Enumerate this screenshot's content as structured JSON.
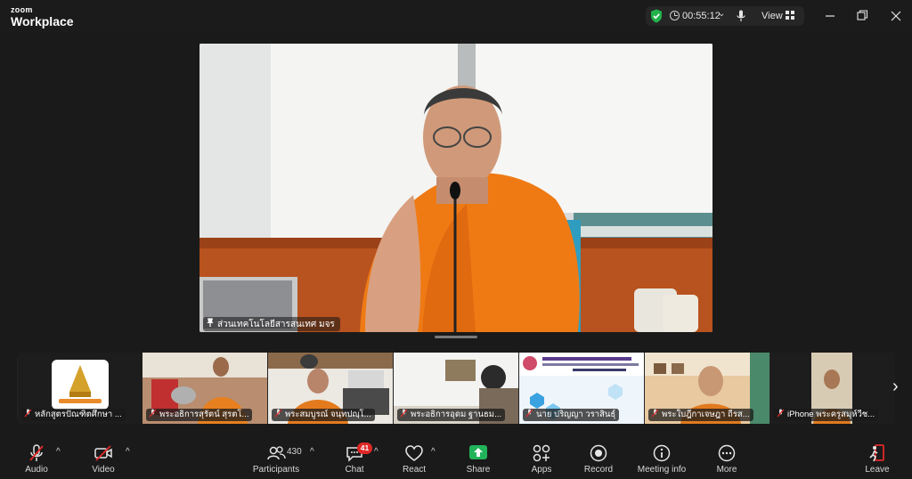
{
  "app": {
    "brand_top": "zoom",
    "brand_bottom": "Workplace"
  },
  "titlebar": {
    "timer": "00:55:12",
    "view_label": "View"
  },
  "main_video": {
    "name": "ส่วนเทคโนโลยีสารสนเทศ มจร"
  },
  "participants_strip": [
    {
      "name": "หลักสูตรปัณฑิตศึกษา ...",
      "muted": true
    },
    {
      "name": "พระอธิการสุรัตน์ สุรตโ...",
      "muted": true
    },
    {
      "name": "พระสมบูรณ์ จนฺทปญฺโ...",
      "muted": true
    },
    {
      "name": "พระอธิการอุดม ฐานธม...",
      "muted": true
    },
    {
      "name": "นาย ปริญญา วราสินธุ์",
      "muted": true
    },
    {
      "name": "พระใบฎีกาเจษฎา ถีรส...",
      "muted": true
    },
    {
      "name": "iPhone พระครูสมุห์วีช...",
      "muted": true
    }
  ],
  "toolbar": {
    "audio": "Audio",
    "video": "Video",
    "participants": "Participants",
    "participants_count": "430",
    "chat": "Chat",
    "chat_badge": "41",
    "react": "React",
    "share": "Share",
    "apps": "Apps",
    "record": "Record",
    "meeting_info": "Meeting info",
    "more": "More",
    "leave": "Leave"
  },
  "colors": {
    "share_green": "#21b35a",
    "leave_red": "#e02828",
    "shield_green": "#22b24c",
    "badge_red": "#e02828"
  }
}
